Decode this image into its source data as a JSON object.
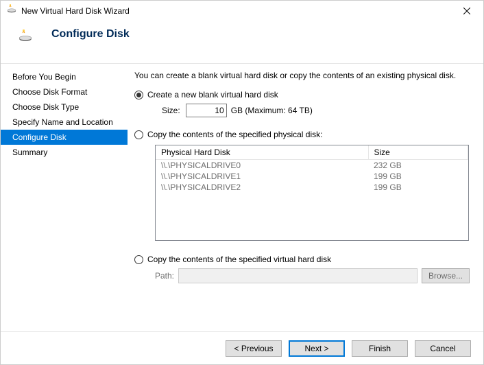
{
  "titlebar": {
    "text": "New Virtual Hard Disk Wizard"
  },
  "header": {
    "title": "Configure Disk"
  },
  "sidebar": {
    "items": [
      {
        "label": "Before You Begin",
        "selected": false
      },
      {
        "label": "Choose Disk Format",
        "selected": false
      },
      {
        "label": "Choose Disk Type",
        "selected": false
      },
      {
        "label": "Specify Name and Location",
        "selected": false
      },
      {
        "label": "Configure Disk",
        "selected": true
      },
      {
        "label": "Summary",
        "selected": false
      }
    ]
  },
  "main": {
    "intro": "You can create a blank virtual hard disk or copy the contents of an existing physical disk.",
    "option_blank": {
      "label": "Create a new blank virtual hard disk",
      "checked": true
    },
    "size": {
      "label": "Size:",
      "value": "10",
      "unit": "GB (Maximum: 64 TB)"
    },
    "option_physical": {
      "label": "Copy the contents of the specified physical disk:",
      "checked": false
    },
    "disk_table": {
      "headers": {
        "name": "Physical Hard Disk",
        "size": "Size"
      },
      "rows": [
        {
          "name": "\\\\.\\PHYSICALDRIVE0",
          "size": "232 GB"
        },
        {
          "name": "\\\\.\\PHYSICALDRIVE1",
          "size": "199 GB"
        },
        {
          "name": "\\\\.\\PHYSICALDRIVE2",
          "size": "199 GB"
        }
      ]
    },
    "option_virtual": {
      "label": "Copy the contents of the specified virtual hard disk",
      "checked": false
    },
    "path": {
      "label": "Path:",
      "browse": "Browse..."
    }
  },
  "footer": {
    "previous": "< Previous",
    "next": "Next >",
    "finish": "Finish",
    "cancel": "Cancel"
  }
}
